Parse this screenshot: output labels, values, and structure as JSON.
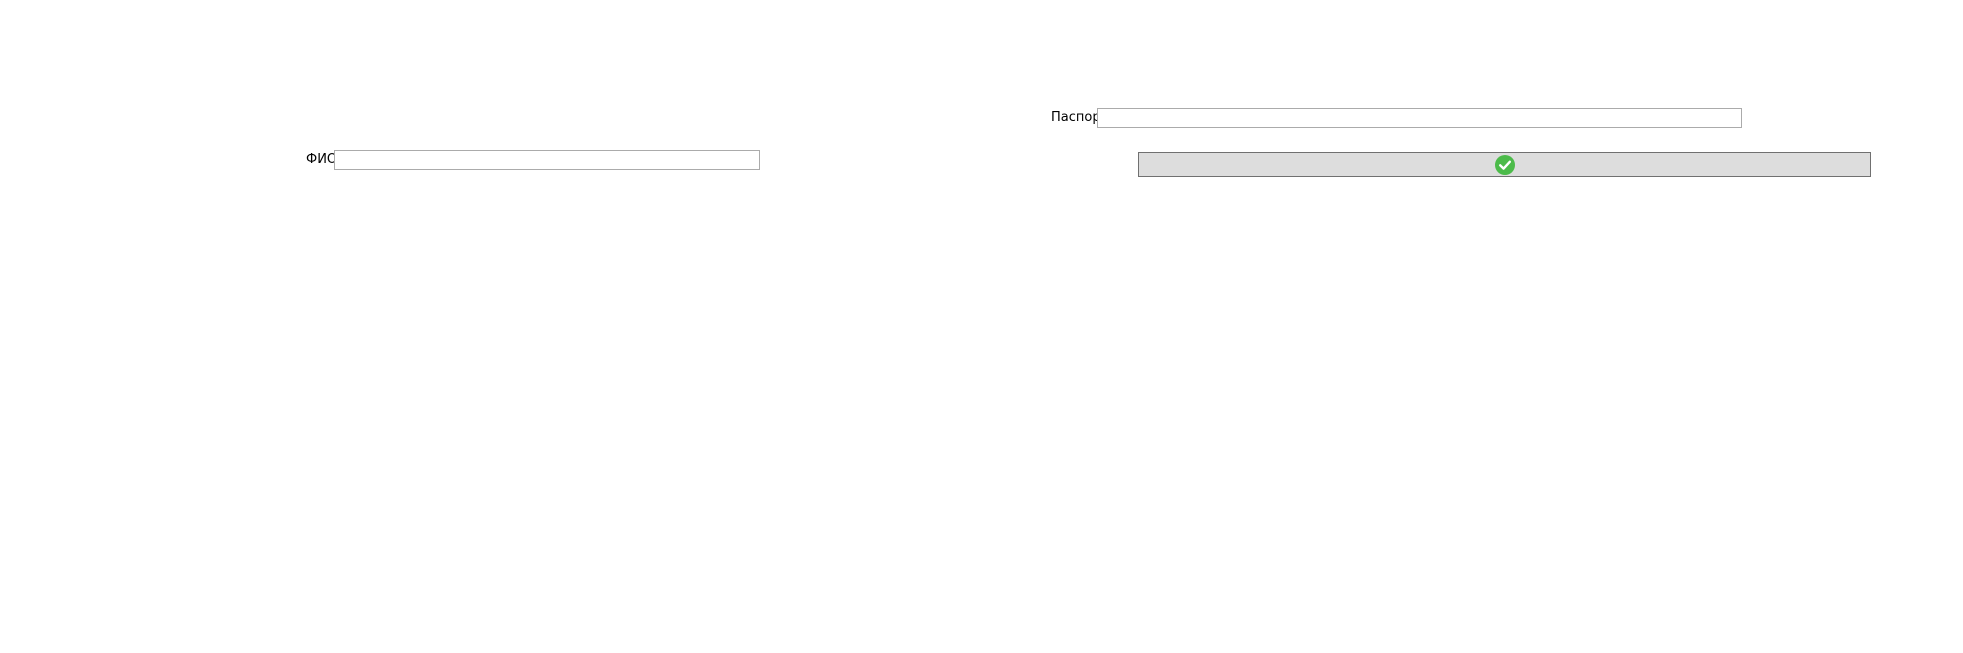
{
  "form": {
    "fio": {
      "label": "ФИО",
      "value": ""
    },
    "passport": {
      "label": "Паспорт",
      "value": ""
    },
    "confirm_button": {
      "icon": "check-circle-icon",
      "icon_color": "#4cbb4a"
    }
  }
}
